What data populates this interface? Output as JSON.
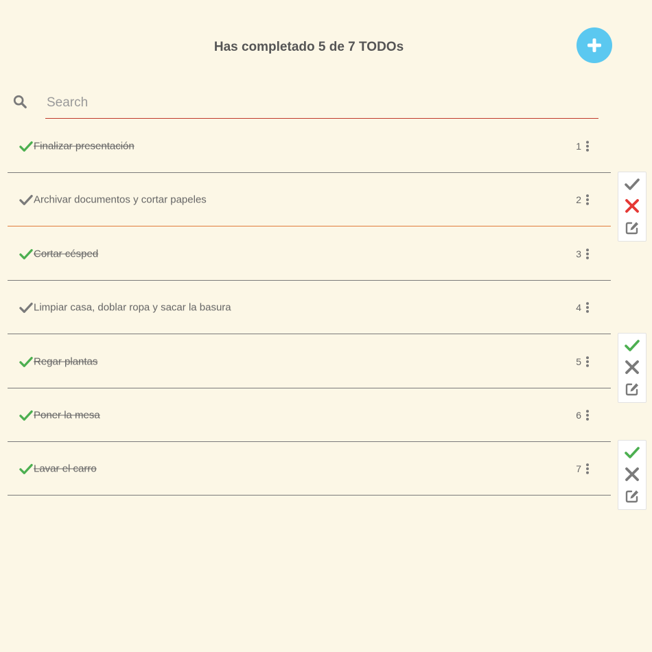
{
  "header": {
    "title": "Has completado 5 de 7 TODOs",
    "add_icon": "plus-icon",
    "add_color": "#5bc8f0"
  },
  "search": {
    "icon": "search-icon",
    "placeholder": "Search",
    "value": ""
  },
  "colors": {
    "background": "#fcf7e6",
    "done_check": "#4caf50",
    "pending_check": "#7a7a7a",
    "delete_active": "#e53935",
    "icon_gray": "#7a7a7a",
    "search_underline": "#c0392b",
    "selected_divider": "#e07b39"
  },
  "todos": [
    {
      "number": "1",
      "text": "Finalizar presentación",
      "done": true
    },
    {
      "number": "2",
      "text": "Archivar documentos y cortar papeles",
      "done": false
    },
    {
      "number": "3",
      "text": "Cortar césped",
      "done": true
    },
    {
      "number": "4",
      "text": "Limpiar casa, doblar ropa y sacar la basura",
      "done": false
    },
    {
      "number": "5",
      "text": "Regar plantas",
      "done": true
    },
    {
      "number": "6",
      "text": "Poner la mesa",
      "done": true
    },
    {
      "number": "7",
      "text": "Lavar el carro",
      "done": true
    }
  ],
  "action_panels": [
    {
      "check_icon": "check-icon",
      "check_state": "gray",
      "delete_icon": "close-icon",
      "delete_state": "red",
      "edit_icon": "edit-icon"
    },
    {
      "check_icon": "check-icon",
      "check_state": "green",
      "delete_icon": "close-icon",
      "delete_state": "gray",
      "edit_icon": "edit-icon"
    },
    {
      "check_icon": "check-icon",
      "check_state": "green",
      "delete_icon": "close-icon",
      "delete_state": "gray",
      "edit_icon": "edit-icon"
    }
  ]
}
